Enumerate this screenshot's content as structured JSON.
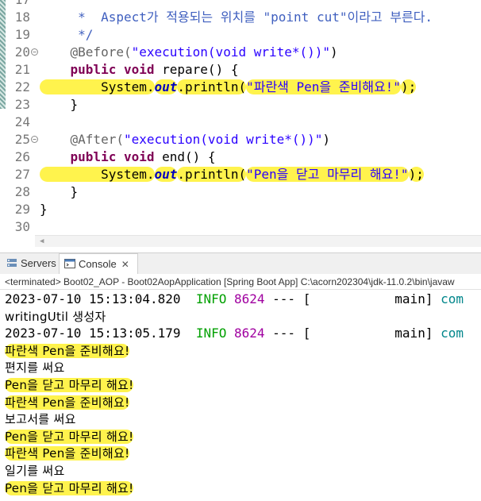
{
  "editor": {
    "lines": [
      {
        "num": "17",
        "parts": [
          {
            "t": "",
            "c": ""
          }
        ]
      },
      {
        "num": "18",
        "parts": [
          {
            "t": "     *  Aspect가 적용되는 위치를 \"point cut\"이라고 부른다.",
            "c": "cmt"
          }
        ]
      },
      {
        "num": "19",
        "parts": [
          {
            "t": "     */",
            "c": "cmt"
          }
        ]
      },
      {
        "num": "20",
        "fold": true,
        "parts": [
          {
            "t": "    @Before(",
            "c": "ann"
          },
          {
            "t": "\"execution(void write*())\"",
            "c": "str"
          },
          {
            "t": ")",
            "c": ""
          }
        ]
      },
      {
        "num": "21",
        "parts": [
          {
            "t": "    ",
            "c": ""
          },
          {
            "t": "public",
            "c": "kw"
          },
          {
            "t": " ",
            "c": ""
          },
          {
            "t": "void",
            "c": "kw"
          },
          {
            "t": " repare() {",
            "c": ""
          }
        ]
      },
      {
        "num": "22",
        "parts": [
          {
            "t": "        System.",
            "c": "hl"
          },
          {
            "t": "out",
            "c": "fld hl"
          },
          {
            "t": ".println(",
            "c": "hl"
          },
          {
            "t": "\"파란색 Pen을 준비해요!\"",
            "c": "str hl"
          },
          {
            "t": ");",
            "c": "hl"
          }
        ]
      },
      {
        "num": "23",
        "parts": [
          {
            "t": "    }",
            "c": ""
          }
        ]
      },
      {
        "num": "24",
        "parts": [
          {
            "t": "",
            "c": ""
          }
        ]
      },
      {
        "num": "25",
        "fold": true,
        "parts": [
          {
            "t": "    @After(",
            "c": "ann"
          },
          {
            "t": "\"execution(void write*())\"",
            "c": "str"
          },
          {
            "t": ")",
            "c": ""
          }
        ]
      },
      {
        "num": "26",
        "parts": [
          {
            "t": "    ",
            "c": ""
          },
          {
            "t": "public",
            "c": "kw"
          },
          {
            "t": " ",
            "c": ""
          },
          {
            "t": "void",
            "c": "kw"
          },
          {
            "t": " end() {",
            "c": ""
          }
        ]
      },
      {
        "num": "27",
        "parts": [
          {
            "t": "        System.",
            "c": "hl"
          },
          {
            "t": "out",
            "c": "fld hl"
          },
          {
            "t": ".println(",
            "c": "hl"
          },
          {
            "t": "\"Pen을 닫고 마무리 해요!\"",
            "c": "str hl"
          },
          {
            "t": ");",
            "c": "hl"
          }
        ]
      },
      {
        "num": "28",
        "parts": [
          {
            "t": "    }",
            "c": ""
          }
        ]
      },
      {
        "num": "29",
        "parts": [
          {
            "t": "}",
            "c": ""
          }
        ]
      },
      {
        "num": "30",
        "parts": [
          {
            "t": "",
            "c": ""
          }
        ]
      }
    ]
  },
  "tabs": {
    "servers": "Servers",
    "console": "Console"
  },
  "console_status": "<terminated> Boot02_AOP - Boot02AopApplication [Spring Boot App] C:\\acorn202304\\jdk-11.0.2\\bin\\javaw",
  "console_lines": [
    {
      "kind": "log",
      "time": "2023-07-10 15:13:04.820",
      "level": "INFO",
      "pid": "8624",
      "sep": " --- [",
      "thread": "           main] ",
      "logger": "com"
    },
    {
      "kind": "out",
      "text": "writingUtil 생성자",
      "highlight": false
    },
    {
      "kind": "log",
      "time": "2023-07-10 15:13:05.179",
      "level": "INFO",
      "pid": "8624",
      "sep": " --- [",
      "thread": "           main] ",
      "logger": "com"
    },
    {
      "kind": "out",
      "text": "파란색 Pen을 준비해요!",
      "highlight": true
    },
    {
      "kind": "out",
      "text": "편지를 써요",
      "highlight": false
    },
    {
      "kind": "out",
      "text": "Pen을 닫고 마무리 해요!",
      "highlight": true
    },
    {
      "kind": "out",
      "text": "파란색 Pen을 준비해요!",
      "highlight": true
    },
    {
      "kind": "out",
      "text": "보고서를 써요",
      "highlight": false
    },
    {
      "kind": "out",
      "text": "Pen을 닫고 마무리 해요!",
      "highlight": true
    },
    {
      "kind": "out",
      "text": "파란색 Pen을 준비해요!",
      "highlight": true
    },
    {
      "kind": "out",
      "text": "일기를 써요",
      "highlight": false
    },
    {
      "kind": "out",
      "text": "Pen을 닫고 마무리 해요!",
      "highlight": true
    }
  ],
  "icons": {
    "servers": "servers-icon",
    "console": "console-icon",
    "close": "close-icon",
    "fold": "fold-collapse-icon"
  },
  "colors": {
    "keyword": "#7f0055",
    "string": "#2a00ff",
    "annotation": "#646464",
    "comment": "#3f5fbf",
    "highlighter": "#fff34d",
    "info": "#00a000"
  }
}
